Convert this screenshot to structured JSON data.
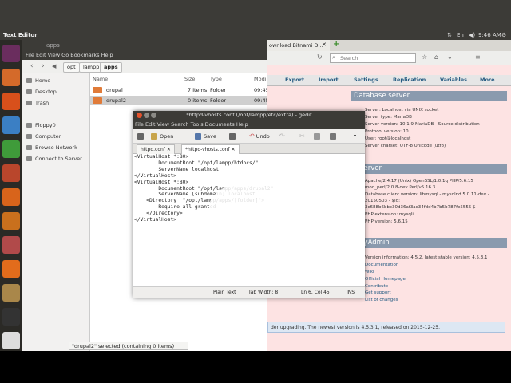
{
  "panel": {
    "title": "Text Editor",
    "time": "9:46 AM",
    "lang": "En"
  },
  "launcher": [
    {
      "name": "ubuntu-dash-icon",
      "color": "#6a2d5e"
    },
    {
      "name": "files-icon",
      "color": "#d46a2a"
    },
    {
      "name": "firefox-icon",
      "color": "#d8501b"
    },
    {
      "name": "writer-icon",
      "color": "#3b7fc4"
    },
    {
      "name": "calc-icon",
      "color": "#3f9b3a"
    },
    {
      "name": "impress-icon",
      "color": "#b9462c"
    },
    {
      "name": "software-center-icon",
      "color": "#d8641b"
    },
    {
      "name": "amazon-icon",
      "color": "#c9701d"
    },
    {
      "name": "settings-icon",
      "color": "#b14a4a"
    },
    {
      "name": "xampp-icon",
      "color": "#e26c1c"
    },
    {
      "name": "archive-icon",
      "color": "#a9874a"
    },
    {
      "name": "terminal-icon",
      "color": "#333333"
    },
    {
      "name": "text-editor-icon",
      "color": "#dddddd"
    }
  ],
  "file_manager": {
    "title": "apps",
    "menu": [
      "File",
      "Edit",
      "View",
      "Go",
      "Bookmarks",
      "Help"
    ],
    "breadcrumb": [
      "opt",
      "lampp",
      "apps"
    ],
    "sidebar": [
      "Home",
      "Desktop",
      "Trash",
      "Floppy0",
      "Computer",
      "Browse Network",
      "Connect to Server"
    ],
    "columns": {
      "name": "Name",
      "size": "Size",
      "type": "Type",
      "modified": "Modi"
    },
    "rows": [
      {
        "name": "drupal",
        "size": "7 items",
        "type": "Folder",
        "modified": "09:45"
      },
      {
        "name": "drupal2",
        "size": "0 items",
        "type": "Folder",
        "modified": "09:45"
      }
    ],
    "status": "\"drupal2\" selected  (containing 0 items)"
  },
  "browser": {
    "tab_label": "ownload Bitnami D...",
    "search_placeholder": "Search",
    "pma_tabs": [
      "Export",
      "Import",
      "Settings",
      "Replication",
      "Variables",
      "More"
    ],
    "database_server": {
      "heading": "Database server",
      "items": [
        "Server: Localhost via UNIX socket",
        "Server type: MariaDB",
        "Server version: 10.1.9-MariaDB - Source distribution",
        "Protocol version: 10",
        "User: root@localhost",
        "Server charset: UTF-8 Unicode (utf8)"
      ]
    },
    "web_server": {
      "heading": "b server",
      "items": [
        "Apache/2.4.17 (Unix) OpenSSL/1.0.1q PHP/5.6.15",
        "mod_perl/2.0.8-dev Perl/v5.16.3",
        "Database client version: libmysql - mysqlnd 5.0.11-dev -",
        "20150503 - $Id:",
        "3c688b6bbc30d36af3ac34fdd4b7b5b787fe5555 $",
        "PHP extension: mysqli",
        "PHP version: 5.6.15"
      ]
    },
    "phpmyadmin": {
      "heading": "oMyAdmin",
      "version": "Version information: 4.5.2, latest stable version: 4.5.3.1",
      "links": [
        "Documentation",
        "Wiki",
        "Official Homepage",
        "Contribute",
        "Get support",
        "List of changes"
      ]
    },
    "notice": "der upgrading. The newest version is 4.5.3.1, released on 2015-12-25."
  },
  "gedit": {
    "title": "*httpd-vhosts.conf (/opt/lampp/etc/extra) - gedit",
    "menu": [
      "File",
      "Edit",
      "View",
      "Search",
      "Tools",
      "Documents",
      "Help"
    ],
    "toolbar": {
      "open": "Open",
      "save": "Save",
      "undo": "Undo"
    },
    "tabs": [
      "httpd.conf",
      "*httpd-vhosts.conf"
    ],
    "code": "<VirtualHost *:80>\n        DocumentRoot \"/opt/lampp/htdocs/\"\n        ServerName localhost\n</VirtualHost>\n<VirtualHost *:80>\n        DocumentRoot \"/opt/lampp/apps/drupal2\"\n        ServerName [subdomain].localhost\n    <Directory  \"/opt/lampp/apps/[folder]\">\n        Require all granted\n    </Directory>\n</VirtualHost>",
    "status": {
      "lang": "Plain Text",
      "tab_width": "Tab Width: 8",
      "position": "Ln 6, Col 45",
      "mode": "INS"
    }
  }
}
